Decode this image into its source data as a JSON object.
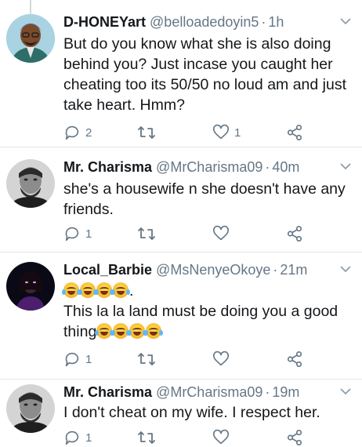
{
  "tweets": [
    {
      "name": "D-HONEYart",
      "handle": "@belloadedoyin5",
      "sep": "·",
      "time": "1h",
      "body": "But do you know what she is also doing behind you? Just incase you caught her cheating too its 50/50 no loud am and just take heart. Hmm?",
      "reply_count": "2",
      "retweet_count": "",
      "like_count": "1"
    },
    {
      "name": "Mr. Charisma",
      "handle": "@MrCharisma09",
      "sep": "·",
      "time": "40m",
      "body": "she's a housewife n she doesn't have any friends.",
      "reply_count": "1",
      "retweet_count": "",
      "like_count": ""
    },
    {
      "name": "Local_Barbie",
      "handle": "@MsNenyeOkoye",
      "sep": "·",
      "time": "21m",
      "body_line1_suffix": ".",
      "body_line2": "This la la land must be doing you a good",
      "body_line3": "thing",
      "reply_count": "1",
      "retweet_count": "",
      "like_count": ""
    },
    {
      "name": "Mr. Charisma",
      "handle": "@MrCharisma09",
      "sep": "·",
      "time": "19m",
      "body": "I don't cheat on my wife. I respect her.",
      "reply_count": "1",
      "retweet_count": "",
      "like_count": ""
    }
  ],
  "icons": {
    "reply": "reply-icon",
    "retweet": "retweet-icon",
    "like": "heart-icon",
    "share": "share-icon",
    "more": "chevron-down-icon",
    "emoji": "face-with-tears-of-joy-emoji"
  },
  "colors": {
    "text": "#14171a",
    "secondary": "#657786",
    "divider": "#e1e8ed"
  }
}
